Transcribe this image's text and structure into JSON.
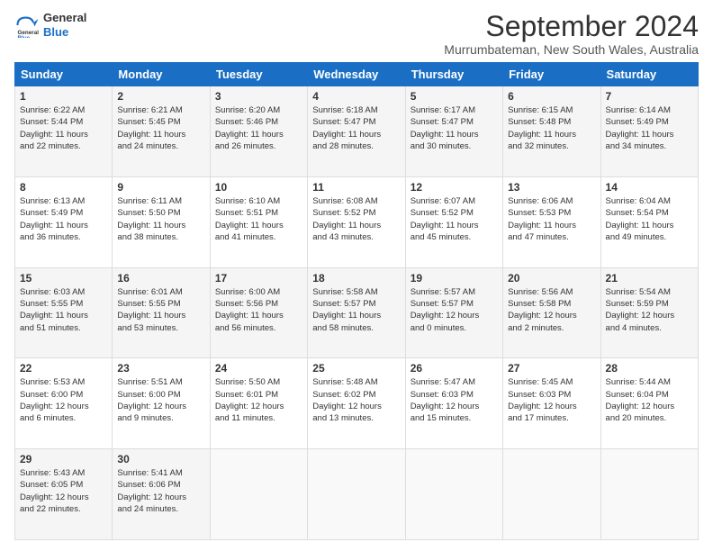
{
  "logo": {
    "line1": "General",
    "line2": "Blue"
  },
  "title": "September 2024",
  "location": "Murrumbateman, New South Wales, Australia",
  "headers": [
    "Sunday",
    "Monday",
    "Tuesday",
    "Wednesday",
    "Thursday",
    "Friday",
    "Saturday"
  ],
  "weeks": [
    [
      {
        "day": "1",
        "sunrise": "6:22 AM",
        "sunset": "5:44 PM",
        "daylight": "11 hours and 22 minutes."
      },
      {
        "day": "2",
        "sunrise": "6:21 AM",
        "sunset": "5:45 PM",
        "daylight": "11 hours and 24 minutes."
      },
      {
        "day": "3",
        "sunrise": "6:20 AM",
        "sunset": "5:46 PM",
        "daylight": "11 hours and 26 minutes."
      },
      {
        "day": "4",
        "sunrise": "6:18 AM",
        "sunset": "5:47 PM",
        "daylight": "11 hours and 28 minutes."
      },
      {
        "day": "5",
        "sunrise": "6:17 AM",
        "sunset": "5:47 PM",
        "daylight": "11 hours and 30 minutes."
      },
      {
        "day": "6",
        "sunrise": "6:15 AM",
        "sunset": "5:48 PM",
        "daylight": "11 hours and 32 minutes."
      },
      {
        "day": "7",
        "sunrise": "6:14 AM",
        "sunset": "5:49 PM",
        "daylight": "11 hours and 34 minutes."
      }
    ],
    [
      {
        "day": "8",
        "sunrise": "6:13 AM",
        "sunset": "5:49 PM",
        "daylight": "11 hours and 36 minutes."
      },
      {
        "day": "9",
        "sunrise": "6:11 AM",
        "sunset": "5:50 PM",
        "daylight": "11 hours and 38 minutes."
      },
      {
        "day": "10",
        "sunrise": "6:10 AM",
        "sunset": "5:51 PM",
        "daylight": "11 hours and 41 minutes."
      },
      {
        "day": "11",
        "sunrise": "6:08 AM",
        "sunset": "5:52 PM",
        "daylight": "11 hours and 43 minutes."
      },
      {
        "day": "12",
        "sunrise": "6:07 AM",
        "sunset": "5:52 PM",
        "daylight": "11 hours and 45 minutes."
      },
      {
        "day": "13",
        "sunrise": "6:06 AM",
        "sunset": "5:53 PM",
        "daylight": "11 hours and 47 minutes."
      },
      {
        "day": "14",
        "sunrise": "6:04 AM",
        "sunset": "5:54 PM",
        "daylight": "11 hours and 49 minutes."
      }
    ],
    [
      {
        "day": "15",
        "sunrise": "6:03 AM",
        "sunset": "5:55 PM",
        "daylight": "11 hours and 51 minutes."
      },
      {
        "day": "16",
        "sunrise": "6:01 AM",
        "sunset": "5:55 PM",
        "daylight": "11 hours and 53 minutes."
      },
      {
        "day": "17",
        "sunrise": "6:00 AM",
        "sunset": "5:56 PM",
        "daylight": "11 hours and 56 minutes."
      },
      {
        "day": "18",
        "sunrise": "5:58 AM",
        "sunset": "5:57 PM",
        "daylight": "11 hours and 58 minutes."
      },
      {
        "day": "19",
        "sunrise": "5:57 AM",
        "sunset": "5:57 PM",
        "daylight": "12 hours and 0 minutes."
      },
      {
        "day": "20",
        "sunrise": "5:56 AM",
        "sunset": "5:58 PM",
        "daylight": "12 hours and 2 minutes."
      },
      {
        "day": "21",
        "sunrise": "5:54 AM",
        "sunset": "5:59 PM",
        "daylight": "12 hours and 4 minutes."
      }
    ],
    [
      {
        "day": "22",
        "sunrise": "5:53 AM",
        "sunset": "6:00 PM",
        "daylight": "12 hours and 6 minutes."
      },
      {
        "day": "23",
        "sunrise": "5:51 AM",
        "sunset": "6:00 PM",
        "daylight": "12 hours and 9 minutes."
      },
      {
        "day": "24",
        "sunrise": "5:50 AM",
        "sunset": "6:01 PM",
        "daylight": "12 hours and 11 minutes."
      },
      {
        "day": "25",
        "sunrise": "5:48 AM",
        "sunset": "6:02 PM",
        "daylight": "12 hours and 13 minutes."
      },
      {
        "day": "26",
        "sunrise": "5:47 AM",
        "sunset": "6:03 PM",
        "daylight": "12 hours and 15 minutes."
      },
      {
        "day": "27",
        "sunrise": "5:45 AM",
        "sunset": "6:03 PM",
        "daylight": "12 hours and 17 minutes."
      },
      {
        "day": "28",
        "sunrise": "5:44 AM",
        "sunset": "6:04 PM",
        "daylight": "12 hours and 20 minutes."
      }
    ],
    [
      {
        "day": "29",
        "sunrise": "5:43 AM",
        "sunset": "6:05 PM",
        "daylight": "12 hours and 22 minutes."
      },
      {
        "day": "30",
        "sunrise": "5:41 AM",
        "sunset": "6:06 PM",
        "daylight": "12 hours and 24 minutes."
      },
      null,
      null,
      null,
      null,
      null
    ]
  ]
}
